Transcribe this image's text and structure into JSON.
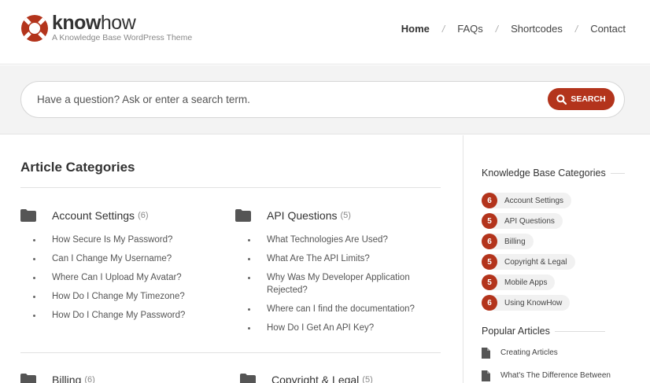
{
  "brand": {
    "name_bold": "know",
    "name_light": "how",
    "tagline": "A Knowledge Base WordPress Theme",
    "color": "#b3341c"
  },
  "nav": [
    {
      "label": "Home",
      "active": true
    },
    {
      "label": "FAQs",
      "active": false
    },
    {
      "label": "Shortcodes",
      "active": false
    },
    {
      "label": "Contact",
      "active": false
    }
  ],
  "search": {
    "placeholder": "Have a question? Ask or enter a search term.",
    "button_label": "SEARCH"
  },
  "main": {
    "title": "Article Categories",
    "categories": [
      {
        "title": "Account Settings",
        "count": "(6)",
        "articles": [
          "How Secure Is My Password?",
          "Can I Change My Username?",
          "Where Can I Upload My Avatar?",
          "How Do I Change My Timezone?",
          "How Do I Change My Password?"
        ]
      },
      {
        "title": "API Questions",
        "count": "(5)",
        "articles": [
          "What Technologies Are Used?",
          "What Are The API Limits?",
          "Why Was My Developer Application Rejected?",
          "Where can I find the documentation?",
          "How Do I Get An API Key?"
        ]
      },
      {
        "title": "Billing",
        "count": "(6)"
      },
      {
        "title": "Copyright & Legal",
        "count": "(5)"
      }
    ]
  },
  "sidebar": {
    "kb_title": "Knowledge Base Categories",
    "kb_items": [
      {
        "count": "6",
        "label": "Account Settings"
      },
      {
        "count": "5",
        "label": "API Questions"
      },
      {
        "count": "6",
        "label": "Billing"
      },
      {
        "count": "5",
        "label": "Copyright & Legal"
      },
      {
        "count": "5",
        "label": "Mobile Apps"
      },
      {
        "count": "6",
        "label": "Using KnowHow"
      }
    ],
    "popular_title": "Popular Articles",
    "popular": [
      "Creating Articles",
      "What's The Difference Between"
    ]
  }
}
